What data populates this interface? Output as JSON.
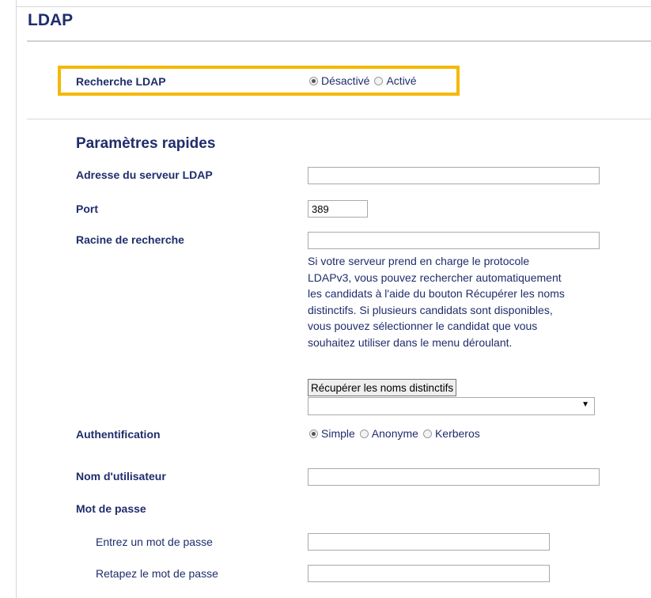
{
  "page": {
    "title": "LDAP"
  },
  "ldap_search": {
    "label": "Recherche LDAP",
    "options": [
      "Désactivé",
      "Activé"
    ],
    "selected": "Désactivé"
  },
  "quick_settings": {
    "heading": "Paramètres rapides",
    "server_address": {
      "label": "Adresse du serveur LDAP",
      "value": ""
    },
    "port": {
      "label": "Port",
      "value": "389"
    },
    "search_root": {
      "label": "Racine de recherche",
      "value": "",
      "help_lines": [
        "Si votre serveur prend en charge le protocole",
        "LDAPv3, vous pouvez rechercher automatiquement",
        "les candidats à l'aide du bouton Récupérer les noms",
        "distinctifs. Si plusieurs candidats sont disponibles,",
        "vous pouvez sélectionner le candidat que vous",
        "souhaitez utiliser dans le menu déroulant."
      ],
      "fetch_button": "Récupérer les noms distinctifs",
      "dropdown_value": ""
    },
    "authentication": {
      "label": "Authentification",
      "options": [
        "Simple",
        "Anonyme",
        "Kerberos"
      ],
      "selected": "Simple"
    },
    "username": {
      "label": "Nom d'utilisateur",
      "value": ""
    },
    "password": {
      "label": "Mot de passe",
      "enter_label": "Entrez un mot de passe",
      "retype_label": "Retapez le mot de passe"
    }
  },
  "colors": {
    "label_text": "#1f2d6b",
    "highlight_border": "#f5b800"
  }
}
